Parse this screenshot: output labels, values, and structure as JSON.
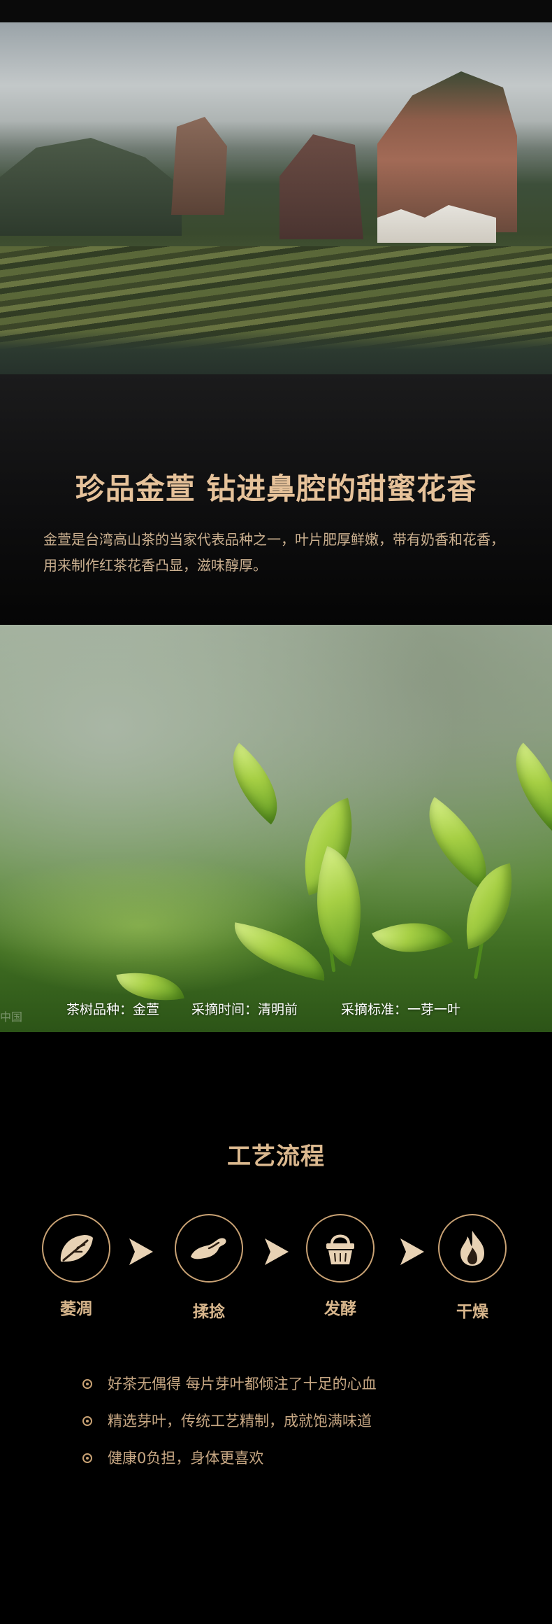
{
  "intro": {
    "headline": "珍品金萱  钻进鼻腔的甜蜜花香",
    "description": "金萱是台湾高山茶的当家代表品种之一，叶片肥厚鲜嫩，带有奶香和花香，用来制作红茶花香凸显，滋味醇厚。"
  },
  "tea_info": {
    "variety": "茶树品种：金萱",
    "picking_time": "采摘时间：清明前",
    "picking_standard": "采摘标准：一芽一叶",
    "watermark": "中国"
  },
  "process": {
    "title": "工艺流程",
    "steps": [
      {
        "label": "萎凋",
        "icon": "leaf-icon"
      },
      {
        "label": "揉捻",
        "icon": "rolling-hand-icon"
      },
      {
        "label": "发酵",
        "icon": "basket-icon"
      },
      {
        "label": "干燥",
        "icon": "flame-icon"
      }
    ],
    "arrow_icon": "chevron-right-icon",
    "accent_color": "#c9a274"
  },
  "bullets": [
    "好茶无偶得 每片芽叶都倾注了十足的心血",
    "精选芽叶，传统工艺精制，成就饱满味道",
    "健康0负担，身体更喜欢"
  ]
}
